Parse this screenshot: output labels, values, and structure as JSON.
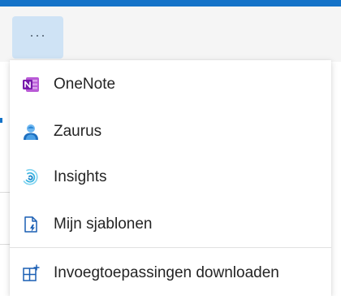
{
  "toolbar": {
    "more_label": "···"
  },
  "menu": {
    "items": [
      {
        "label": "OneNote",
        "icon": "onenote-icon"
      },
      {
        "label": "Zaurus",
        "icon": "zaurus-icon"
      },
      {
        "label": "Insights",
        "icon": "insights-icon"
      },
      {
        "label": "Mijn sjablonen",
        "icon": "templates-icon"
      },
      {
        "label": "Invoegtoepassingen downloaden",
        "icon": "add-ins-icon"
      }
    ]
  },
  "colors": {
    "accent": "#1473c8",
    "onenote": "#7719aa",
    "highlight": "#cfe3f5"
  }
}
